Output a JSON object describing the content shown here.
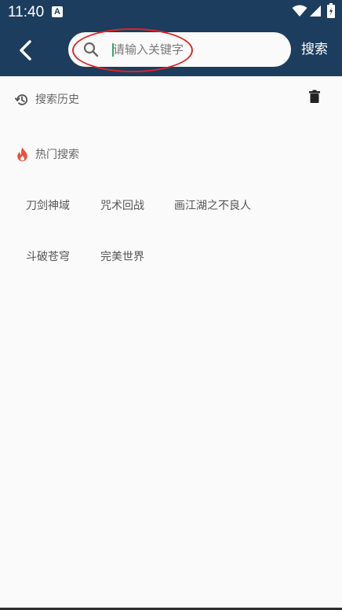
{
  "status_bar": {
    "time": "11:40",
    "notification_icon": "A",
    "icons": [
      "wifi-icon",
      "signal-icon",
      "battery-icon"
    ]
  },
  "header": {
    "back_icon": "chevron-left-icon",
    "search_icon": "search-icon",
    "search_placeholder": "请输入关键字",
    "search_value": "",
    "search_button_label": "搜索"
  },
  "history": {
    "icon": "history-icon",
    "title": "搜索历史",
    "delete_icon": "trash-icon",
    "items": []
  },
  "hot": {
    "icon": "flame-icon",
    "title": "热门搜索",
    "tags": [
      "刀剑神域",
      "咒术回战",
      "画江湖之不良人",
      "斗破苍穹",
      "完美世界"
    ]
  },
  "colors": {
    "header_bg": "#1c3d5e",
    "page_bg": "#fafafa",
    "flame": "#e8533f",
    "annotation_oval": "#e02424",
    "caret": "#35a870"
  }
}
